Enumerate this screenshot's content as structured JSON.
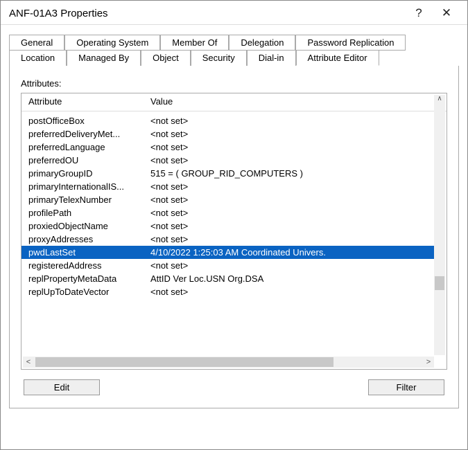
{
  "titlebar": {
    "title": "ANF-01A3 Properties",
    "help": "?",
    "close": "✕"
  },
  "tabs": {
    "row1": [
      "General",
      "Operating System",
      "Member Of",
      "Delegation",
      "Password Replication"
    ],
    "row2": [
      "Location",
      "Managed By",
      "Object",
      "Security",
      "Dial-in",
      "Attribute Editor"
    ],
    "active": "Attribute Editor"
  },
  "attributes_label": "Attributes:",
  "columns": {
    "attr": "Attribute",
    "val": "Value"
  },
  "rows": [
    {
      "attr": "postOfficeBox",
      "val": "<not set>"
    },
    {
      "attr": "preferredDeliveryMet...",
      "val": "<not set>"
    },
    {
      "attr": "preferredLanguage",
      "val": "<not set>"
    },
    {
      "attr": "preferredOU",
      "val": "<not set>"
    },
    {
      "attr": "primaryGroupID",
      "val": "515 = ( GROUP_RID_COMPUTERS )"
    },
    {
      "attr": "primaryInternationalIS...",
      "val": "<not set>"
    },
    {
      "attr": "primaryTelexNumber",
      "val": "<not set>"
    },
    {
      "attr": "profilePath",
      "val": "<not set>"
    },
    {
      "attr": "proxiedObjectName",
      "val": "<not set>"
    },
    {
      "attr": "proxyAddresses",
      "val": "<not set>"
    },
    {
      "attr": "pwdLastSet",
      "val": "4/10/2022 1:25:03 AM Coordinated Univers.",
      "selected": true
    },
    {
      "attr": "registeredAddress",
      "val": "<not set>"
    },
    {
      "attr": "replPropertyMetaData",
      "val": " AttID  Ver      Loc.USN                  Org.DSA"
    },
    {
      "attr": "replUpToDateVector",
      "val": "<not set>"
    }
  ],
  "buttons": {
    "edit": "Edit",
    "filter": "Filter"
  }
}
